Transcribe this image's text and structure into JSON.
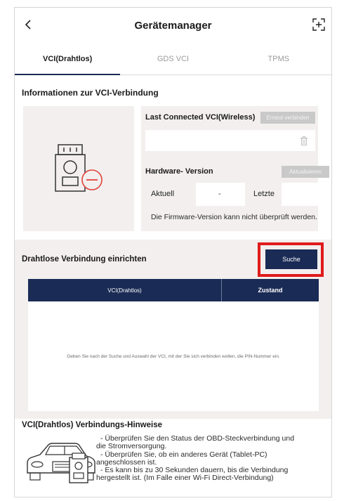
{
  "header": {
    "title": "Gerätemanager",
    "back_icon": "chevron-left-icon",
    "scan_icon": "scan-add-icon"
  },
  "tabs": [
    {
      "label": "VCI(Drahtlos)",
      "active": true
    },
    {
      "label": "GDS VCI",
      "active": false
    },
    {
      "label": "TPMS",
      "active": false
    }
  ],
  "info": {
    "section_title": "Informationen zur VCI-Verbindung",
    "last_connected_label": "Last Connected VCI(Wireless)",
    "reconnect_label": "Erneut verbinden",
    "hardware_version_label": "Hardware- Version",
    "update_label": "Aktualisieren",
    "current_label": "Aktuell",
    "current_value": "-",
    "latest_label": "Letzte",
    "firmware_note": "Die Firmware-Version kann nicht überprüft werden."
  },
  "setup": {
    "title": "Drahtlose Verbindung einrichten",
    "search_label": "Suche",
    "columns": [
      "VCI(Drahtlos)",
      "Zustand"
    ],
    "empty_hint": "Geben Sie nach der Suche und Auswahl der VCI, mit der Sie sich verbinden wollen, die PIN-Nummer ein."
  },
  "hints": {
    "title": "VCI(Drahtlos) Verbindungs-Hinweise",
    "lines": [
      "- Überprüfen Sie den Status der OBD-Steckverbindung und",
      "die Stromversorgung.",
      "- Überprüfen Sie, ob ein anderes Gerät (Tablet-PC)",
      "angeschlossen ist.",
      "- Es kann bis zu 30 Sekunden dauern, bis die Verbindung",
      "hergestellt ist. (Im Falle einer Wi-Fi Direct-Verbindung)"
    ]
  },
  "colors": {
    "navy": "#1a2b55",
    "panel_bg": "#f2efee",
    "highlight_red": "#e01b1b",
    "alert_red": "#e0433a"
  }
}
